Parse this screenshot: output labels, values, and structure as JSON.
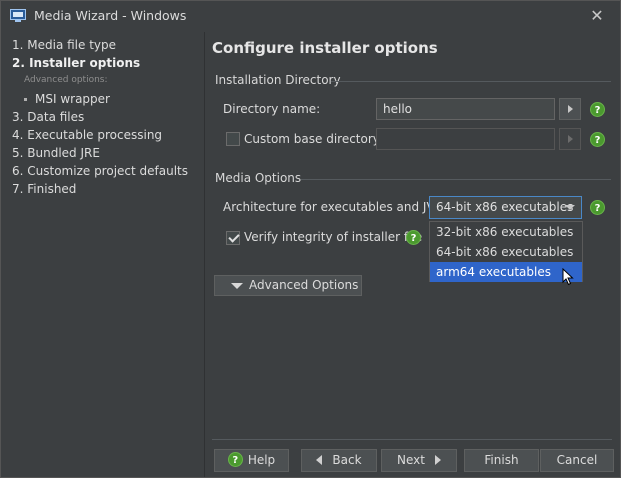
{
  "window": {
    "title": "Media Wizard - Windows",
    "close_glyph": "✕"
  },
  "sidebar": {
    "items": [
      {
        "label": "1. Media file type",
        "active": false
      },
      {
        "label": "2. Installer options",
        "active": true
      },
      {
        "label": "3. Data files",
        "active": false
      },
      {
        "label": "4. Executable processing",
        "active": false
      },
      {
        "label": "5. Bundled JRE",
        "active": false
      },
      {
        "label": "6. Customize project defaults",
        "active": false
      },
      {
        "label": "7. Finished",
        "active": false
      }
    ],
    "advanced_label": "Advanced options:",
    "sub_items": [
      {
        "label": "MSI wrapper"
      }
    ]
  },
  "main": {
    "title": "Configure installer options",
    "install_dir": {
      "heading": "Installation Directory",
      "dir_name_label": "Directory name:",
      "dir_name_value": "hello",
      "custom_base_label": "Custom base directory:",
      "custom_base_checked": false,
      "custom_base_value": ""
    },
    "media_options": {
      "heading": "Media Options",
      "arch_label": "Architecture for executables and JVM:",
      "arch_selected": "64-bit x86 executables",
      "arch_options": [
        {
          "label": "32-bit x86 executables",
          "highlighted": false
        },
        {
          "label": "64-bit x86 executables",
          "highlighted": false
        },
        {
          "label": "arm64 executables",
          "highlighted": true
        }
      ],
      "verify_label": "Verify integrity of installer file",
      "verify_checked": true
    },
    "advanced_button": "Advanced Options"
  },
  "footer": {
    "help": "Help",
    "back": "Back",
    "next": "Next",
    "finish": "Finish",
    "cancel": "Cancel"
  },
  "icons": {
    "help_glyph": "?",
    "help_color": "#4b9a2f",
    "selection_color": "#2f65ca"
  }
}
